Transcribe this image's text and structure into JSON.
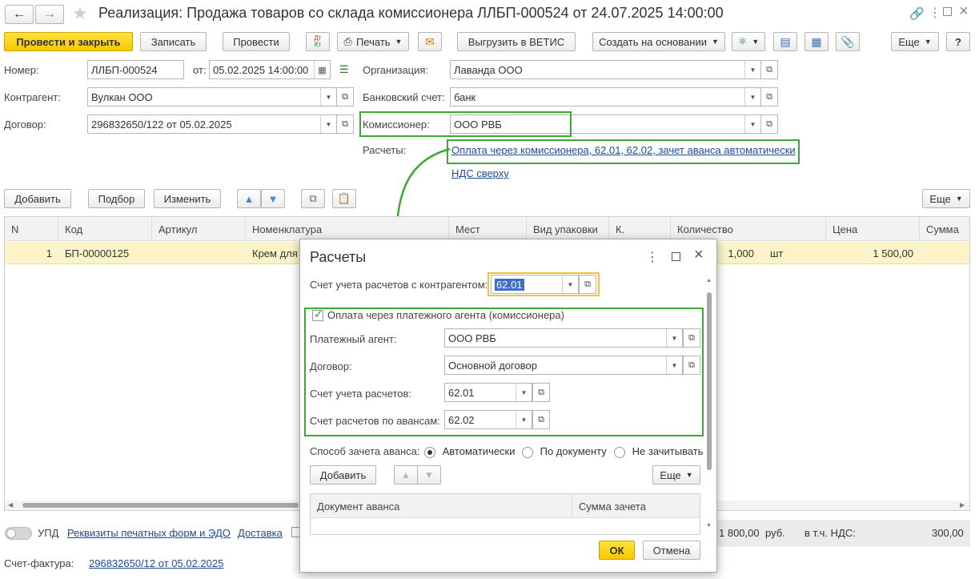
{
  "window": {
    "title": "Реализация: Продажа товаров со склада комиссионера ЛЛБП-000524 от 24.07.2025 14:00:00"
  },
  "toolbar": {
    "post_close": "Провести и закрыть",
    "save": "Записать",
    "post": "Провести",
    "dt_kt": "Дт\nКт",
    "print": "Печать",
    "export_vetis": "Выгрузить в ВЕТИС",
    "create_based": "Создать на основании",
    "more": "Еще",
    "help": "?"
  },
  "form": {
    "number_label": "Номер:",
    "number_value": "ЛЛБП-000524",
    "date_label": "от:",
    "date_value": "05.02.2025 14:00:00",
    "org_label": "Организация:",
    "org_value": "Лаванда ООО",
    "counterparty_label": "Контрагент:",
    "counterparty_value": "Вулкан ООО",
    "bank_label": "Банковский счет:",
    "bank_value": "банк",
    "contract_label": "Договор:",
    "contract_value": "296832650/122 от 05.02.2025",
    "commissioner_label": "Комиссионер:",
    "commissioner_value": "ООО РВБ",
    "settlements_label": "Расчеты:",
    "settlements_link": "Оплата через комиссионера, 62.01, 62.02, зачет аванса автоматически",
    "vat_link": "НДС сверху"
  },
  "table_toolbar": {
    "add": "Добавить",
    "pick": "Подбор",
    "change": "Изменить",
    "more": "Еще"
  },
  "table": {
    "columns": [
      "N",
      "Код",
      "Артикул",
      "Номенклатура",
      "Мест",
      "Вид упаковки",
      "К.",
      "Количество",
      "Цена",
      "Сумма"
    ],
    "rows": [
      {
        "n": "1",
        "code": "БП-00000125",
        "article": "",
        "name": "Крем для",
        "qty": "1,000",
        "unit": "шт",
        "price": "1 500,00"
      }
    ]
  },
  "footer": {
    "upd": "УПД",
    "print_forms_link": "Реквизиты печатных форм и ЭДО",
    "delivery_link": "Доставка",
    "total": "1 800,00",
    "currency": "руб.",
    "vat_label": "в т.ч. НДС:",
    "vat_value": "300,00",
    "invoice_label": "Счет-фактура:",
    "invoice_link": "296832650/12 от 05.02.2025"
  },
  "dialog": {
    "title": "Расчеты",
    "account_label": "Счет учета расчетов с контрагентом:",
    "account_value": "62.01",
    "agent_checkbox": "Оплата через платежного агента (комиссионера)",
    "agent_label": "Платежный агент:",
    "agent_value": "ООО РВБ",
    "contract_label": "Договор:",
    "contract_value": "Основной договор",
    "settle_account_label": "Счет учета расчетов:",
    "settle_account_value": "62.01",
    "advance_account_label": "Счет расчетов по авансам:",
    "advance_account_value": "62.02",
    "offset_label": "Способ зачета аванса:",
    "offset_options": [
      "Автоматически",
      "По документу",
      "Не зачитывать"
    ],
    "add": "Добавить",
    "more": "Еще",
    "col_doc": "Документ аванса",
    "col_sum": "Сумма зачета",
    "ok": "ОК",
    "cancel": "Отмена"
  },
  "colors": {
    "accent_yellow": "#f7c800",
    "highlight_green": "#3aaa35",
    "row_selected": "#fcf3c8",
    "link_blue": "#1a4b9a"
  }
}
